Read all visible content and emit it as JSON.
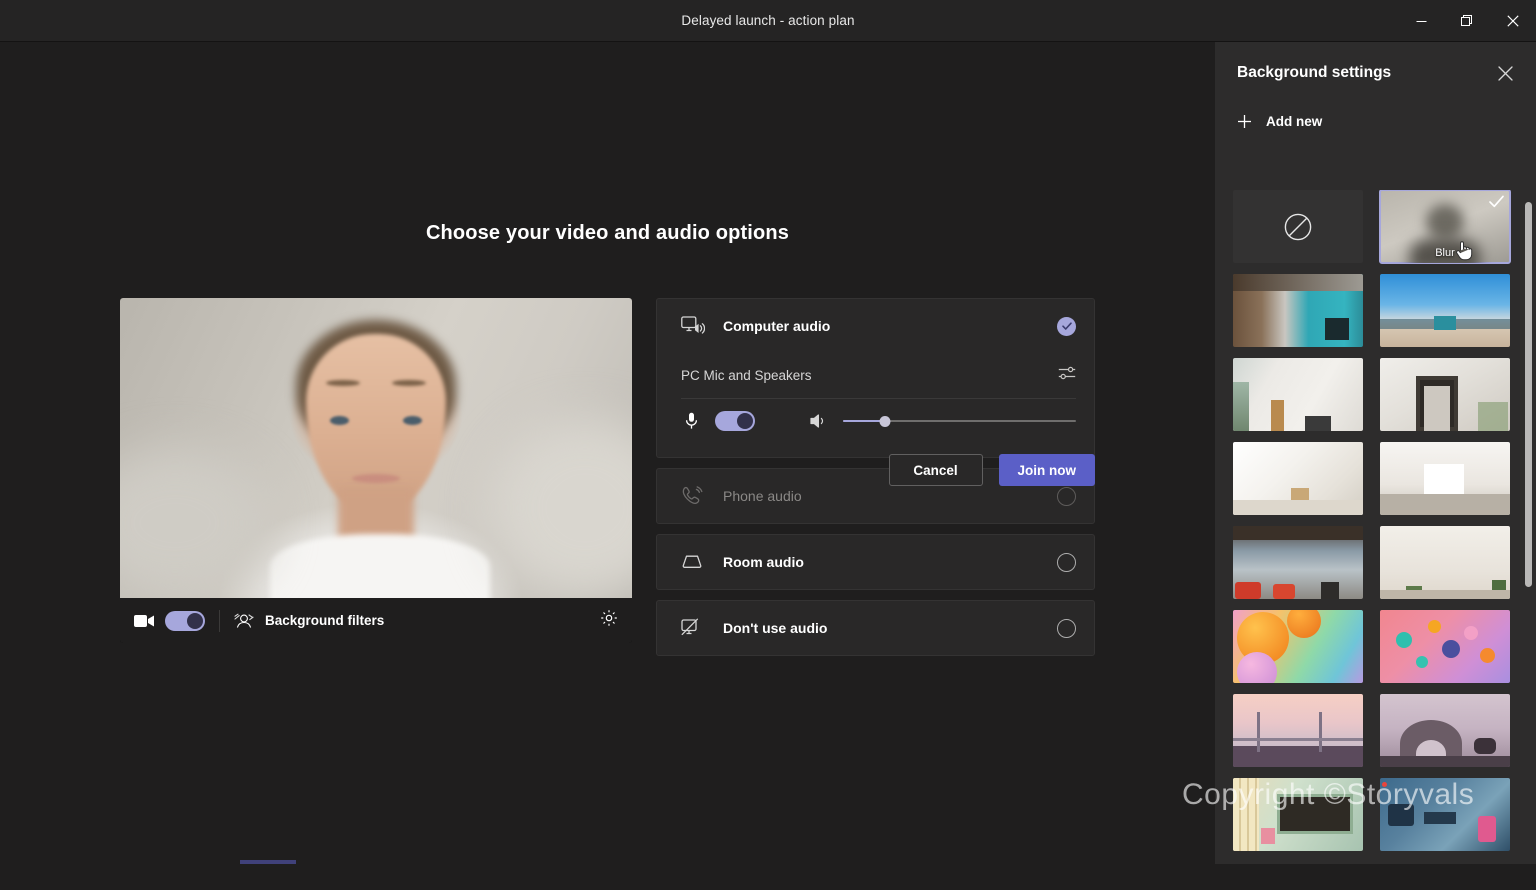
{
  "window": {
    "title": "Delayed launch - action plan",
    "controls": [
      {
        "name": "minimize",
        "label": "Minimize"
      },
      {
        "name": "restore",
        "label": "Restore"
      },
      {
        "name": "close",
        "label": "Close"
      }
    ]
  },
  "stage": {
    "heading": "Choose your video and audio options"
  },
  "video_preview": {
    "camera_toggle_state": "on",
    "background_filters_label": "Background filters",
    "device_settings_icon": "gear-icon",
    "camera_icon": "camera-icon",
    "effects_icon": "background-effects-icon"
  },
  "audio": {
    "options": [
      {
        "id": "computer-audio",
        "label": "Computer audio",
        "icon": "computer-speaker-icon",
        "selected": true,
        "disabled": false
      },
      {
        "id": "phone-audio",
        "label": "Phone audio",
        "icon": "phone-icon",
        "selected": false,
        "disabled": true
      },
      {
        "id": "room-audio",
        "label": "Room audio",
        "icon": "room-device-icon",
        "selected": false,
        "disabled": false
      },
      {
        "id": "dont-use-audio",
        "label": "Don't use audio",
        "icon": "no-audio-icon",
        "selected": false,
        "disabled": false
      }
    ],
    "device": {
      "name": "PC Mic and Speakers",
      "settings_icon": "audio-settings-icon",
      "mic_toggle_state": "on",
      "mic_icon": "microphone-icon",
      "speaker_icon": "speaker-icon",
      "volume_percent": 18
    }
  },
  "actions": {
    "cancel_label": "Cancel",
    "join_label": "Join now"
  },
  "background_settings": {
    "title": "Background settings",
    "close_icon": "close-icon",
    "add_new_label": "Add new",
    "add_new_icon": "plus-icon",
    "hovered_label": "Blur",
    "thumbnails": [
      {
        "id": "none",
        "label": "None",
        "kind": "none",
        "selected": false
      },
      {
        "id": "blur",
        "label": "Blur",
        "kind": "blur",
        "selected": true,
        "hovered": true
      },
      {
        "id": "office-lockers",
        "label": "Office with teal lockers",
        "kind": "image",
        "selected": false
      },
      {
        "id": "beach-sky",
        "label": "Beach under blue sky",
        "kind": "image",
        "selected": false
      },
      {
        "id": "white-room-window",
        "label": "White room with window",
        "kind": "image",
        "selected": false
      },
      {
        "id": "room-with-mirror",
        "label": "Room with mirror",
        "kind": "image",
        "selected": false
      },
      {
        "id": "bright-white-loft",
        "label": "Bright white loft",
        "kind": "image",
        "selected": false
      },
      {
        "id": "white-studio",
        "label": "White studio room",
        "kind": "image",
        "selected": false
      },
      {
        "id": "loft-office-red-chairs",
        "label": "Loft office with red chairs",
        "kind": "image",
        "selected": false
      },
      {
        "id": "plain-wall-plants",
        "label": "Plain wall with plants",
        "kind": "image",
        "selected": false
      },
      {
        "id": "orange-spheres",
        "label": "Orange gradient spheres",
        "kind": "image",
        "selected": false
      },
      {
        "id": "pink-bubbles",
        "label": "Pink and teal bubbles",
        "kind": "image",
        "selected": false
      },
      {
        "id": "illustrated-bridge",
        "label": "Illustrated suspension bridge",
        "kind": "image",
        "selected": false
      },
      {
        "id": "illustrated-arch",
        "label": "Illustrated rock arch",
        "kind": "image",
        "selected": false
      },
      {
        "id": "illustrated-cafe",
        "label": "Illustrated cafe interior",
        "kind": "image",
        "selected": false
      },
      {
        "id": "illustrated-spaceship",
        "label": "Illustrated spaceship interior",
        "kind": "image",
        "selected": false
      }
    ],
    "scrollbar": {
      "name": "background-list-scrollbar"
    }
  },
  "watermark": {
    "text": "Copyright ©Storyvals"
  },
  "colors": {
    "accent": "#5b5fc7",
    "accent_light": "#a6a7dc",
    "app_background": "#1f1e1e",
    "panel_background": "#2d2c2c",
    "titlebar_background": "#252424"
  }
}
